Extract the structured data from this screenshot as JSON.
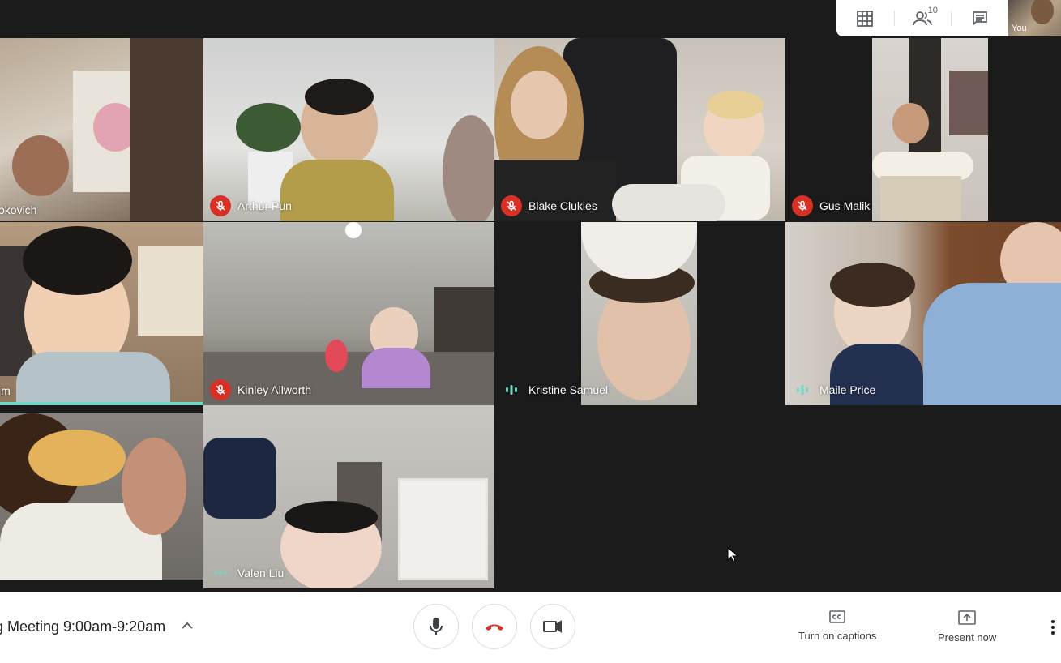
{
  "top_panel": {
    "grid_icon": "grid-view-icon",
    "people_icon": "people-icon",
    "people_count": "10",
    "chat_icon": "chat-icon",
    "self_label": "You"
  },
  "participants": [
    {
      "name": "okovich",
      "state": "none"
    },
    {
      "name": "Arthur Pun",
      "state": "muted"
    },
    {
      "name": "Blake Clukies",
      "state": "muted"
    },
    {
      "name": "Gus Malik",
      "state": "muted"
    },
    {
      "name": "im",
      "state": "none"
    },
    {
      "name": "Kinley Allworth",
      "state": "muted"
    },
    {
      "name": "Kristine Samuel",
      "state": "speaking"
    },
    {
      "name": "Maile Price",
      "state": "speaking"
    },
    {
      "name": "",
      "state": "none"
    },
    {
      "name": "Valen Liu",
      "state": "dots"
    }
  ],
  "bottom_bar": {
    "meeting_title": "g Meeting 9:00am-9:20am",
    "captions_label": "Turn on captions",
    "present_label": "Present now"
  },
  "colors": {
    "muted_red": "#d93025",
    "speaking_teal": "#6fd8c6"
  }
}
